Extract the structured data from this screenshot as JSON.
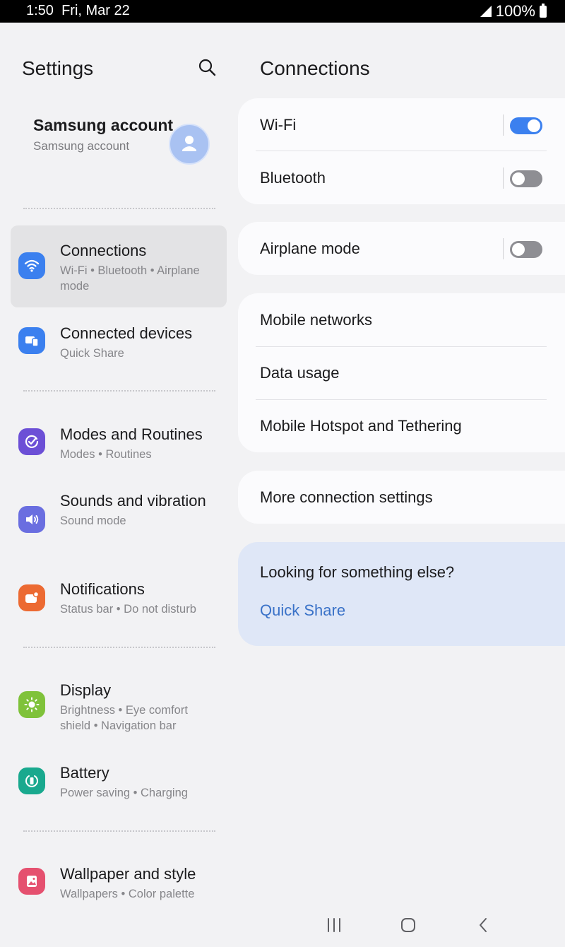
{
  "status_bar": {
    "time": "1:50",
    "date": "Fri, Mar 22",
    "battery": "100%"
  },
  "left_pane": {
    "title": "Settings",
    "account": {
      "name": "Samsung account",
      "subtitle": "Samsung account"
    },
    "items": [
      {
        "title": "Connections",
        "subtitle": "Wi-Fi  •  Bluetooth  •  Airplane mode",
        "icon": "wifi-icon",
        "color": "#3b80ef"
      },
      {
        "title": "Connected devices",
        "subtitle": "Quick Share",
        "icon": "devices-icon",
        "color": "#3b80ef"
      },
      {
        "title": "Modes and Routines",
        "subtitle": "Modes  •  Routines",
        "icon": "check-circle-icon",
        "color": "#6c4fd6"
      },
      {
        "title": "Sounds and vibration",
        "subtitle": "Sound mode",
        "icon": "speaker-icon",
        "color": "#6a6ee0"
      },
      {
        "title": "Notifications",
        "subtitle": "Status bar  •  Do not disturb",
        "icon": "notification-icon",
        "color": "#ec6a32"
      },
      {
        "title": "Display",
        "subtitle": "Brightness  •  Eye comfort shield  •  Navigation bar",
        "icon": "sun-icon",
        "color": "#7fc23a"
      },
      {
        "title": "Battery",
        "subtitle": "Power saving  •  Charging",
        "icon": "battery-icon",
        "color": "#19a98e"
      },
      {
        "title": "Wallpaper and style",
        "subtitle": "Wallpapers  •  Color palette",
        "icon": "wallpaper-icon",
        "color": "#e5506f"
      }
    ]
  },
  "right_pane": {
    "title": "Connections",
    "wifi": {
      "label": "Wi-Fi",
      "on": true
    },
    "bluetooth": {
      "label": "Bluetooth",
      "on": false
    },
    "airplane": {
      "label": "Airplane mode",
      "on": false
    },
    "mobile_networks": "Mobile networks",
    "data_usage": "Data usage",
    "hotspot": "Mobile Hotspot and Tethering",
    "more": "More connection settings",
    "suggest": {
      "title": "Looking for something else?",
      "link": "Quick Share"
    }
  }
}
